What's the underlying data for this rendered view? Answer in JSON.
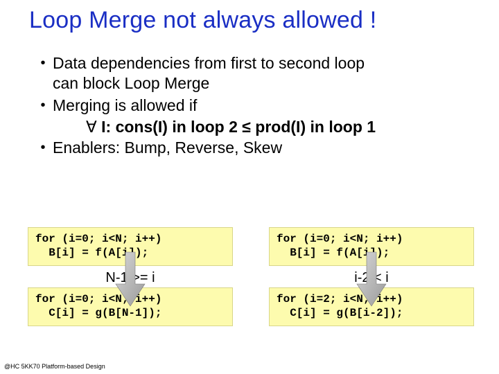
{
  "title": "Loop Merge not always allowed !",
  "bullets": {
    "b1a": "Data dependencies from first to second loop",
    "b1b": "can block Loop Merge",
    "b2": "Merging is allowed if",
    "b2_indent_prefix": "∀",
    "b2_indent_rest": " I: cons(I) in loop 2 ≤ prod(I) in loop 1",
    "b3": "Enablers: Bump, Reverse, Skew"
  },
  "left": {
    "code1": "for (i=0; i<N; i++)\n  B[i] = f(A[i]);",
    "mid": "N-1 >= i",
    "code2": "for (i=0; i<N; i++)\n  C[i] = g(B[N-1]);"
  },
  "right": {
    "code1": "for (i=0; i<N; i++)\n  B[i] = f(A[i]);",
    "mid": "i-2 < i",
    "code2": "for (i=2; i<N; i++)\n  C[i] = g(B[i-2]);"
  },
  "footer": "@HC 5KK70 Platform-based Design",
  "colors": {
    "title": "#1a2ec4",
    "codebg": "#fdfbae"
  }
}
